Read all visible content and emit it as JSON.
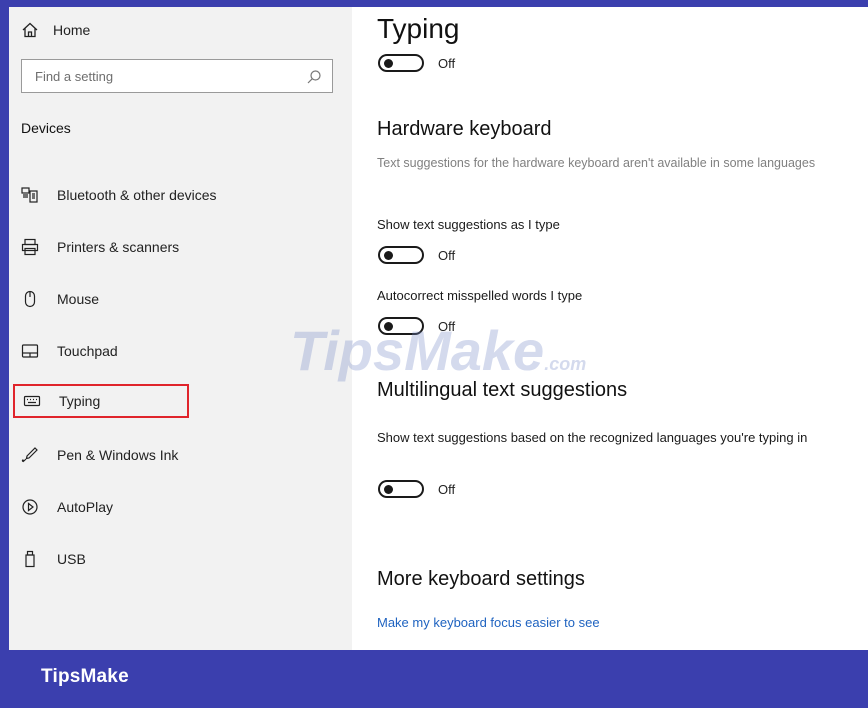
{
  "sidebar": {
    "home_label": "Home",
    "search_placeholder": "Find a setting",
    "section_title": "Devices",
    "items": [
      {
        "label": "Bluetooth & other devices",
        "icon": "bluetooth-devices-icon"
      },
      {
        "label": "Printers & scanners",
        "icon": "printer-icon"
      },
      {
        "label": "Mouse",
        "icon": "mouse-icon"
      },
      {
        "label": "Touchpad",
        "icon": "touchpad-icon"
      },
      {
        "label": "Typing",
        "icon": "keyboard-icon",
        "selected": true
      },
      {
        "label": "Pen & Windows Ink",
        "icon": "pen-icon"
      },
      {
        "label": "AutoPlay",
        "icon": "autoplay-icon"
      },
      {
        "label": "USB",
        "icon": "usb-icon"
      }
    ]
  },
  "main": {
    "title": "Typing",
    "title_toggle_state": "Off",
    "hardware_keyboard": {
      "heading": "Hardware keyboard",
      "description": "Text suggestions for the hardware keyboard aren't available in some languages",
      "show_suggestions_label": "Show text suggestions as I type",
      "show_suggestions_state": "Off",
      "autocorrect_label": "Autocorrect misspelled words I type",
      "autocorrect_state": "Off"
    },
    "multilingual": {
      "heading": "Multilingual text suggestions",
      "label": "Show text suggestions based on the recognized languages you're typing in",
      "state": "Off"
    },
    "more_keyboard": {
      "heading": "More keyboard settings",
      "link": "Make my keyboard focus easier to see"
    }
  },
  "watermark": {
    "text": "TipsMake",
    "suffix": ".com"
  },
  "footer": {
    "brand": "TipsMake"
  },
  "colors": {
    "brand_bar": "#3b3fae",
    "selection_outline": "#e0242b",
    "link": "#1f63c0",
    "sidebar_bg": "#f2f2f2"
  }
}
